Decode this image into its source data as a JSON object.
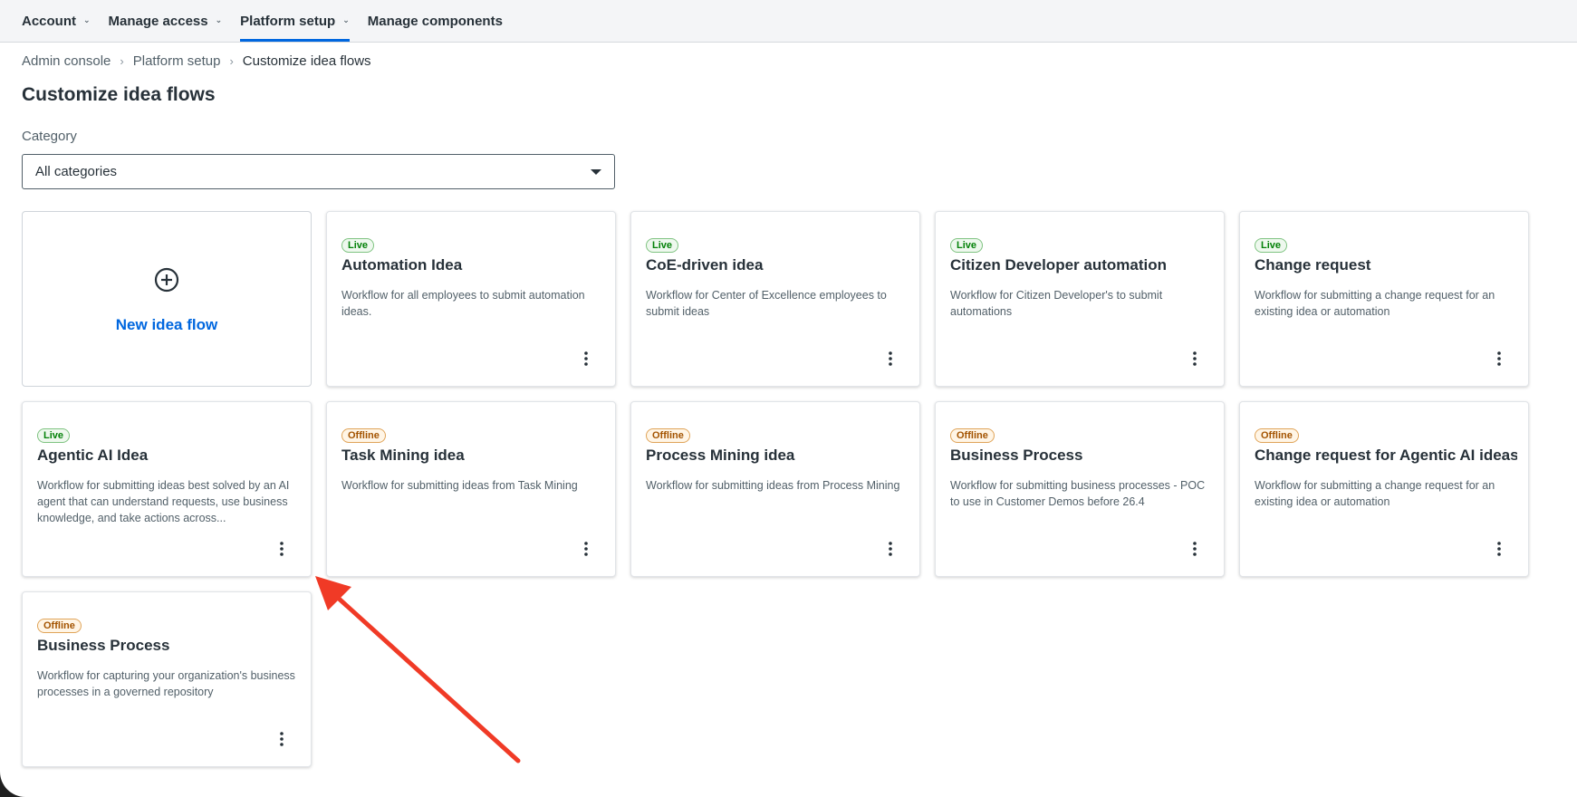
{
  "nav": {
    "items": [
      {
        "label": "Account"
      },
      {
        "label": "Manage access"
      },
      {
        "label": "Platform setup"
      },
      {
        "label": "Manage components"
      }
    ],
    "chevron_icon": "chevron-down-icon"
  },
  "breadcrumb": {
    "items": [
      "Admin console",
      "Platform setup",
      "Customize idea flows"
    ]
  },
  "page": {
    "title": "Customize idea flows"
  },
  "filter": {
    "label": "Category",
    "value": "All categories"
  },
  "new_card": {
    "label": "New idea flow",
    "icon": "plus-circle-icon"
  },
  "cards": [
    {
      "status": "Live",
      "title": "Automation Idea",
      "description": "Workflow for all employees to submit automation ideas."
    },
    {
      "status": "Live",
      "title": "CoE-driven idea",
      "description": "Workflow for Center of Excellence employees to submit ideas"
    },
    {
      "status": "Live",
      "title": "Citizen Developer automation",
      "description": "Workflow for Citizen Developer's to submit automations"
    },
    {
      "status": "Live",
      "title": "Change request",
      "description": "Workflow for submitting a change request for an existing idea or automation"
    },
    {
      "status": "Live",
      "title": "Agentic AI Idea",
      "description": "Workflow for submitting ideas best solved by an AI agent that can understand requests, use business knowledge, and take actions across..."
    },
    {
      "status": "Offline",
      "title": "Task Mining idea",
      "description": "Workflow for submitting ideas from Task Mining"
    },
    {
      "status": "Offline",
      "title": "Process Mining idea",
      "description": "Workflow for submitting ideas from Process Mining"
    },
    {
      "status": "Offline",
      "title": "Business Process",
      "description": "Workflow for submitting business processes - POC to use in Customer Demos before 26.4"
    },
    {
      "status": "Offline",
      "title": "Change request for Agentic AI ideas",
      "description": "Workflow for submitting a change request for an existing idea or automation"
    },
    {
      "status": "Offline",
      "title": "Business Process",
      "description": "Workflow for capturing your organization's business processes in a governed repository"
    }
  ],
  "colors": {
    "accent": "#0067df",
    "live": "#038108",
    "offline": "#a35300",
    "annotation_arrow": "#f03a26"
  }
}
